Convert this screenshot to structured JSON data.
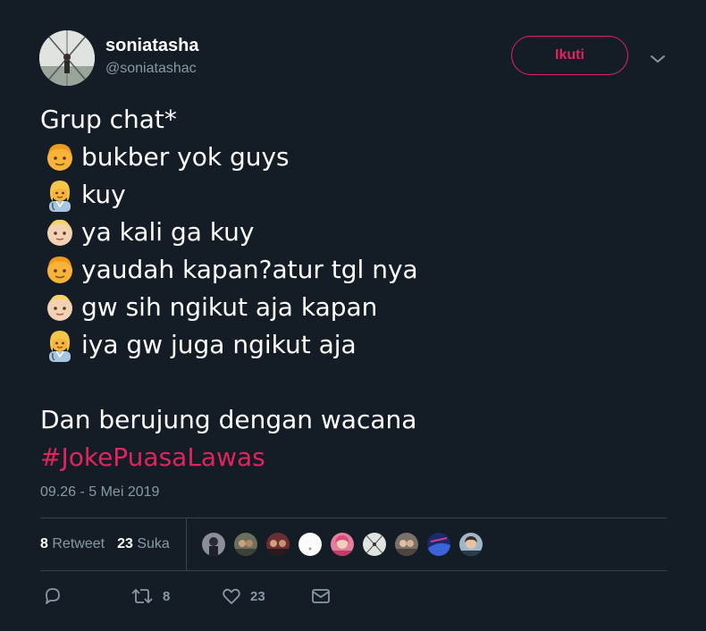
{
  "author": {
    "name": "soniatasha",
    "handle": "@soniatashac",
    "avatar_icon": "profile-photo-icon"
  },
  "follow_label": "Ikuti",
  "menu_icon": "chevron-down-icon",
  "tweet": {
    "lines": [
      {
        "emoji": "",
        "text": "Grup chat*"
      },
      {
        "emoji": "boy-emoji",
        "text": "bukber yok guys"
      },
      {
        "emoji": "woman-health-worker-emoji",
        "text": "kuy"
      },
      {
        "emoji": "baby-light-skin-emoji",
        "text": "ya kali ga kuy"
      },
      {
        "emoji": "boy-emoji",
        "text": "yaudah kapan?atur tgl nya"
      },
      {
        "emoji": "baby-light-skin-emoji",
        "text": "gw sih ngikut aja kapan"
      },
      {
        "emoji": "woman-health-worker-emoji",
        "text": "iya gw juga ngikut aja"
      },
      {
        "emoji": "",
        "text": ""
      },
      {
        "emoji": "",
        "text": "Dan berujung dengan wacana"
      }
    ],
    "hashtag": "#JokePuasaLawas"
  },
  "timestamp": "09.26 - 5 Mei 2019",
  "stats": {
    "retweets_count": "8",
    "retweets_label": "Retweet",
    "likes_count": "23",
    "likes_label": "Suka"
  },
  "likers": [
    {
      "icon": "liker-avatar-1"
    },
    {
      "icon": "liker-avatar-2"
    },
    {
      "icon": "liker-avatar-3"
    },
    {
      "icon": "liker-avatar-4"
    },
    {
      "icon": "liker-avatar-5"
    },
    {
      "icon": "liker-avatar-6"
    },
    {
      "icon": "liker-avatar-7"
    },
    {
      "icon": "liker-avatar-8"
    },
    {
      "icon": "liker-avatar-9"
    }
  ],
  "actions": {
    "reply": {
      "icon": "reply-icon",
      "count": ""
    },
    "retweet": {
      "icon": "retweet-icon",
      "count": "8"
    },
    "like": {
      "icon": "heart-icon",
      "count": "23"
    },
    "message": {
      "icon": "envelope-icon",
      "count": ""
    }
  },
  "colors": {
    "background": "#141d26",
    "accent": "#e0245e",
    "secondary_text": "#8899a6",
    "divider": "#38444d"
  }
}
